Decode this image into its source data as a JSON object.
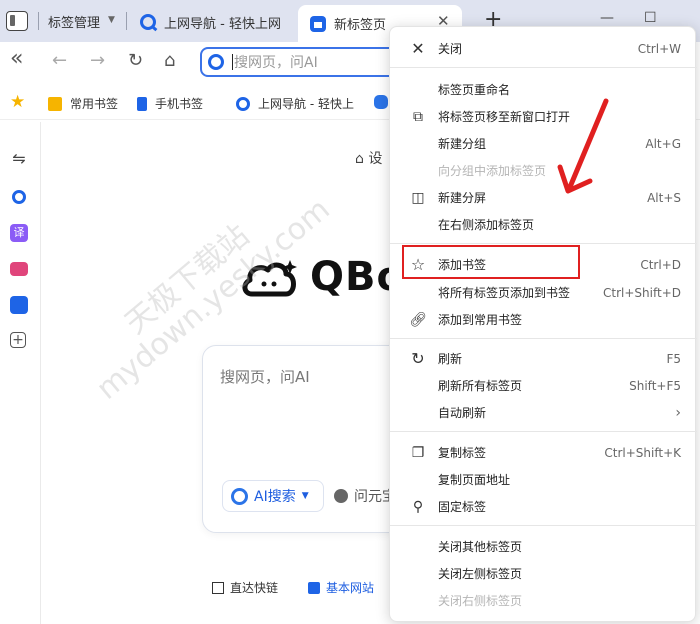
{
  "tabstrip": {
    "group_label": "标签管理",
    "tabs": [
      {
        "label": "上网导航 - 轻快上网"
      },
      {
        "label": "新标签页"
      }
    ]
  },
  "toolbar": {
    "address_placeholder": "搜网页，问AI"
  },
  "bookmarks": {
    "items": [
      {
        "label": "常用书签"
      },
      {
        "label": "手机书签"
      },
      {
        "label": "上网导航 - 轻快上"
      }
    ]
  },
  "sidebar": {
    "translate_label": "译"
  },
  "main": {
    "settings_label": "设",
    "logo_text": "QBo",
    "search_placeholder": "搜网页，问AI",
    "ai_search_label": "AI搜索",
    "wen_label": "问元宝",
    "quick_links": [
      {
        "label": "直达快链"
      },
      {
        "label": "基本网站"
      }
    ],
    "watermark_1": "天极下载站",
    "watermark_2": "mydown.yesky.com"
  },
  "menu": {
    "items": [
      {
        "label": "关闭",
        "shortcut": "Ctrl+W",
        "icon": "close-icon",
        "disabled": false
      },
      {
        "label": "标签页重命名",
        "shortcut": "",
        "icon": "",
        "disabled": false
      },
      {
        "label": "将标签页移至新窗口打开",
        "shortcut": "",
        "icon": "new-window-icon",
        "disabled": false
      },
      {
        "label": "新建分组",
        "shortcut": "Alt+G",
        "icon": "",
        "disabled": false
      },
      {
        "label": "向分组中添加标签页",
        "shortcut": "",
        "icon": "",
        "disabled": true
      },
      {
        "label": "新建分屏",
        "shortcut": "Alt+S",
        "icon": "split-screen-icon",
        "disabled": false
      },
      {
        "label": "在右侧添加标签页",
        "shortcut": "",
        "icon": "",
        "disabled": false
      },
      {
        "label": "添加书签",
        "shortcut": "Ctrl+D",
        "icon": "star-icon",
        "disabled": false
      },
      {
        "label": "将所有标签页添加到书签",
        "shortcut": "Ctrl+Shift+D",
        "icon": "",
        "disabled": false
      },
      {
        "label": "添加到常用书签",
        "shortcut": "",
        "icon": "link-icon",
        "disabled": false
      },
      {
        "label": "刷新",
        "shortcut": "F5",
        "icon": "refresh-icon",
        "disabled": false
      },
      {
        "label": "刷新所有标签页",
        "shortcut": "Shift+F5",
        "icon": "",
        "disabled": false
      },
      {
        "label": "自动刷新",
        "shortcut": "",
        "icon": "",
        "disabled": false
      },
      {
        "label": "复制标签",
        "shortcut": "Ctrl+Shift+K",
        "icon": "duplicate-icon",
        "disabled": false
      },
      {
        "label": "复制页面地址",
        "shortcut": "",
        "icon": "",
        "disabled": false
      },
      {
        "label": "固定标签",
        "shortcut": "",
        "icon": "pin-icon",
        "disabled": false
      },
      {
        "label": "关闭其他标签页",
        "shortcut": "",
        "icon": "",
        "disabled": false
      },
      {
        "label": "关闭左侧标签页",
        "shortcut": "",
        "icon": "",
        "disabled": false
      },
      {
        "label": "关闭右侧标签页",
        "shortcut": "",
        "icon": "",
        "disabled": true
      }
    ]
  },
  "colors": {
    "accent": "#1e64e6",
    "highlight_box": "#e02020",
    "arrow": "#e02020",
    "bookmark_star": "#f6b400"
  }
}
